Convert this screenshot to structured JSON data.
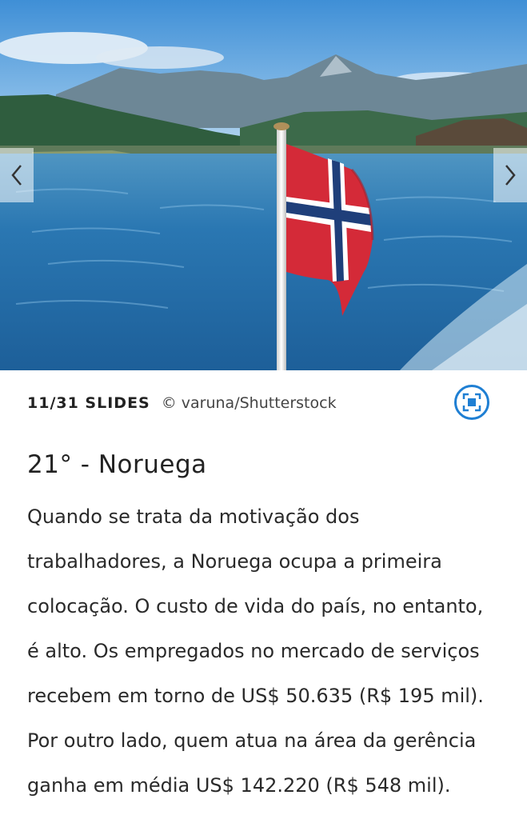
{
  "gallery": {
    "counter": "11/31 SLIDES",
    "credit": "© varuna/Shutterstock",
    "prev_icon": "chevron-left-icon",
    "next_icon": "chevron-right-icon",
    "fullscreen_icon": "fullscreen-icon"
  },
  "slide": {
    "title": "21° - Noruega",
    "body_lines": [
      "Quando se trata da motivação dos",
      "trabalhadores, a Noruega ocupa a primeira",
      "colocação. O custo de vida do país, no entanto,",
      "é alto. Os empregados no mercado de serviços",
      "recebem em torno de US$ 50.635 (R$ 195 mil).",
      "Por outro lado, quem atua na área da gerência",
      "ganha em média US$ 142.220 (R$ 548 mil)."
    ]
  },
  "colors": {
    "accent": "#1f7fd3",
    "text": "#222222",
    "flag_red": "#d42a38",
    "flag_blue": "#1f3f7a"
  }
}
